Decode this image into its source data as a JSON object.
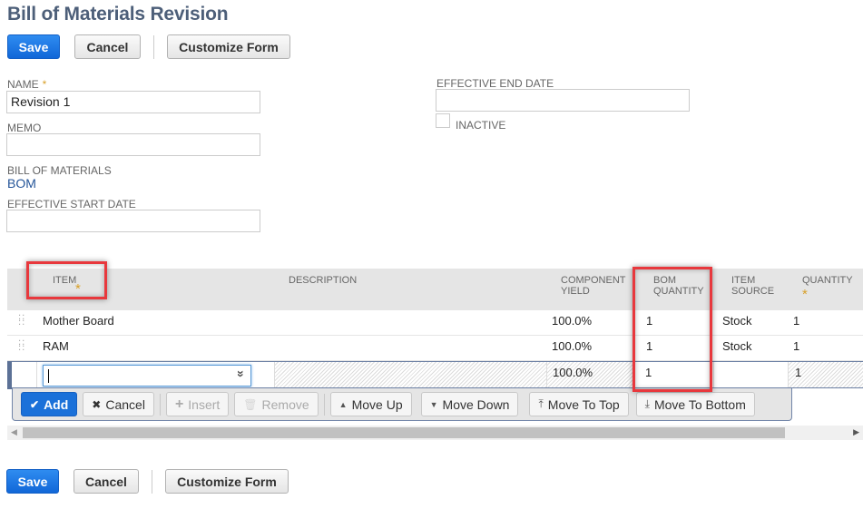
{
  "page": {
    "title": "Bill of Materials Revision"
  },
  "toolbar": {
    "save_label": "Save",
    "cancel_label": "Cancel",
    "customize_label": "Customize Form"
  },
  "form": {
    "name": {
      "label": "NAME",
      "required_mark": "*",
      "value": "Revision 1"
    },
    "memo": {
      "label": "MEMO",
      "value": ""
    },
    "bill_of_materials": {
      "label": "BILL OF MATERIALS",
      "value": "BOM"
    },
    "effective_start_date": {
      "label": "EFFECTIVE START DATE",
      "value": ""
    },
    "effective_end_date": {
      "label": "EFFECTIVE END DATE",
      "value": ""
    },
    "inactive": {
      "label": "INACTIVE",
      "checked": false
    }
  },
  "grid": {
    "columns": {
      "item": "ITEM",
      "description": "DESCRIPTION",
      "component_yield_1": "COMPONENT",
      "component_yield_2": "YIELD",
      "bom_quantity_1": "BOM",
      "bom_quantity_2": "QUANTITY",
      "item_source_1": "ITEM",
      "item_source_2": "SOURCE",
      "quantity": "QUANTITY",
      "required_mark": "*"
    },
    "rows": [
      {
        "item": "Mother Board",
        "description": "",
        "component_yield": "100.0%",
        "bom_quantity": "1",
        "item_source": "Stock",
        "quantity": "1"
      },
      {
        "item": "RAM",
        "description": "",
        "component_yield": "100.0%",
        "bom_quantity": "1",
        "item_source": "Stock",
        "quantity": "1"
      }
    ],
    "edit_row": {
      "item": "",
      "component_yield": "100.0%",
      "bom_quantity": "1",
      "item_source": "",
      "quantity": "1"
    },
    "actions": {
      "add": "Add",
      "cancel": "Cancel",
      "insert": "Insert",
      "remove": "Remove",
      "move_up": "Move Up",
      "move_down": "Move Down",
      "move_to_top": "Move To Top",
      "move_to_bottom": "Move To Bottom"
    }
  },
  "icons": {
    "check": "✔",
    "x": "✖",
    "plus": "+",
    "trash": "🗑",
    "up": "▲",
    "down": "▼",
    "top": "⤒",
    "bottom": "⤓",
    "dropdown": "»"
  }
}
